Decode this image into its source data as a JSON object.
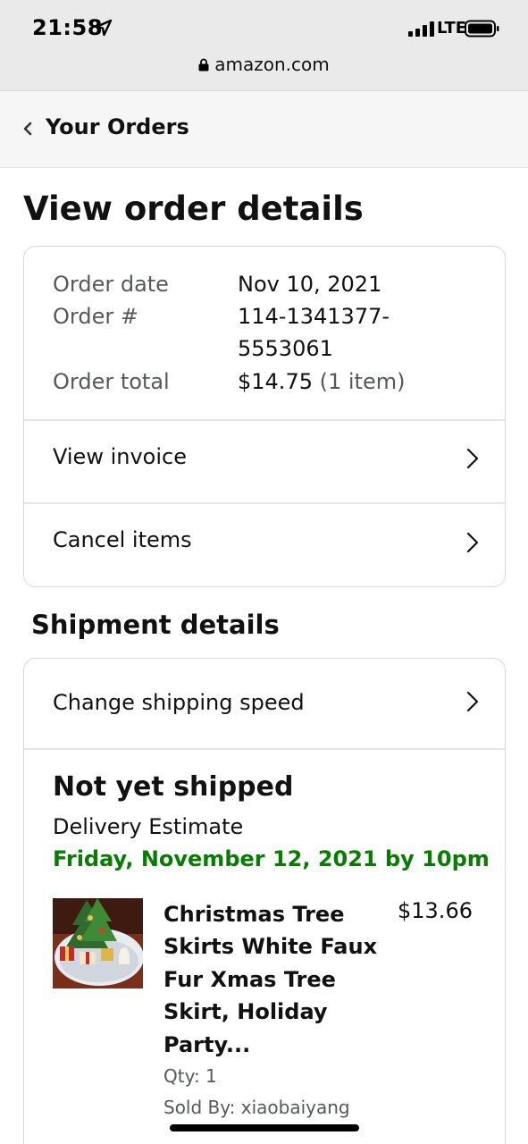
{
  "status_bar": {
    "time": "21:58",
    "network": "LTE",
    "url": "amazon.com"
  },
  "nav": {
    "back_label": "Your Orders"
  },
  "page": {
    "title": "View order details"
  },
  "order_summary": {
    "order_date_label": "Order date",
    "order_date_value": "Nov 10, 2021",
    "order_number_label": "Order #",
    "order_number_line1": "114-1341377-",
    "order_number_line2": "5553061",
    "order_total_label": "Order total",
    "order_total_value": "$14.75",
    "order_total_items": "(1 item)"
  },
  "actions": {
    "view_invoice": "View invoice",
    "cancel_items": "Cancel items"
  },
  "shipment": {
    "section_title": "Shipment details",
    "change_speed": "Change shipping speed",
    "status": "Not yet shipped",
    "delivery_label": "Delivery Estimate",
    "delivery_date": "Friday, November 12, 2021 by 10pm",
    "delivery_color": "#067d00"
  },
  "item": {
    "title": "Christmas Tree Skirts White Faux Fur Xmas Tree Skirt, Holiday Party...",
    "price": "$13.66",
    "quantity": "Qty: 1",
    "seller": "Sold By: xiaobaiyang",
    "image_icon": "product-thumbnail"
  }
}
